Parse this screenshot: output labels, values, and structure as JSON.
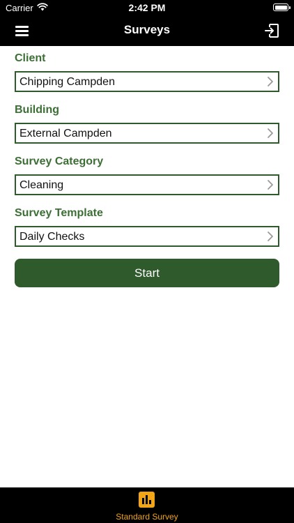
{
  "status_bar": {
    "carrier": "Carrier",
    "time": "2:42 PM"
  },
  "nav": {
    "title": "Surveys"
  },
  "form": {
    "fields": [
      {
        "label": "Client",
        "value": "Chipping Campden"
      },
      {
        "label": "Building",
        "value": "External Campden"
      },
      {
        "label": "Survey Category",
        "value": "Cleaning"
      },
      {
        "label": "Survey Template",
        "value": "Daily Checks"
      }
    ],
    "start_label": "Start"
  },
  "tabbar": {
    "tabs": [
      {
        "label": "Standard Survey",
        "icon": "bar-chart-icon",
        "active": true
      }
    ]
  },
  "colors": {
    "accent_green": "#2f5a2c",
    "label_green": "#3c6e35",
    "tab_active": "#f2a516",
    "bar_background": "#000000"
  }
}
